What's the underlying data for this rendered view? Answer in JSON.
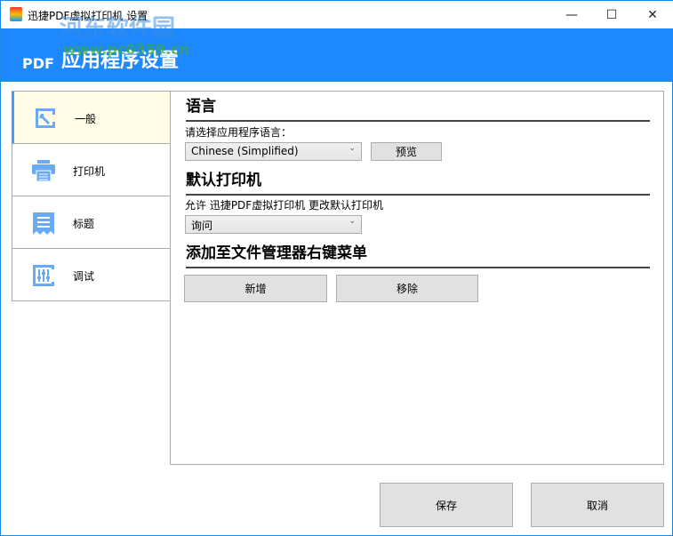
{
  "window": {
    "title": "迅捷PDF虚拟打印机 设置",
    "minimize": "—",
    "maximize": "☐",
    "close": "✕"
  },
  "header": {
    "logo": "PDF",
    "title": "应用程序设置",
    "watermark": "河东软件园",
    "watermark_url": "www.pc0359.cn",
    "color": "#1e88ff"
  },
  "sidebar": {
    "items": [
      {
        "label": "一般",
        "icon": "wrench-icon"
      },
      {
        "label": "打印机",
        "icon": "printer-icon"
      },
      {
        "label": "标题",
        "icon": "title-icon"
      },
      {
        "label": "调试",
        "icon": "debug-icon"
      }
    ]
  },
  "main": {
    "language": {
      "heading": "语言",
      "label": "请选择应用程序语言：",
      "value": "Chinese (Simplified)",
      "preview": "预览"
    },
    "printer": {
      "heading": "默认打印机",
      "label": "允许 迅捷PDF虚拟打印机 更改默认打印机",
      "value": "询问"
    },
    "context_menu": {
      "heading": "添加至文件管理器右键菜单",
      "add": "新增",
      "remove": "移除"
    }
  },
  "footer": {
    "save": "保存",
    "cancel": "取消"
  }
}
